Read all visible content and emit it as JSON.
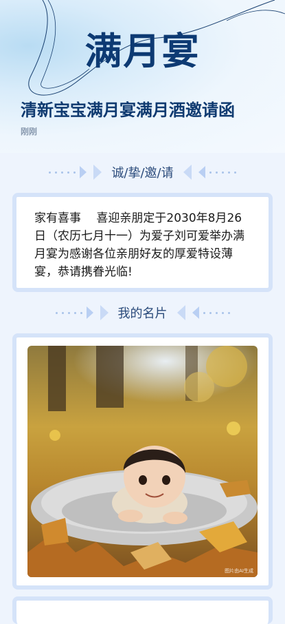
{
  "hero": {
    "title": "满月宴"
  },
  "page": {
    "title": "清新宝宝满月宴满月酒邀请函",
    "time": "刚刚"
  },
  "sections": {
    "invite_heading": "诚/挚/邀/请",
    "invite_text": "家有喜事　 喜迎亲朋定于2030年8月26日（农历七月十一）为爱子刘可爱举办满月宴为感谢各位亲朋好友的厚爱特设薄宴，恭请携眷光临!",
    "card_heading": "我的名片"
  },
  "photo": {
    "watermark": "图片由AI生成"
  },
  "colors": {
    "title_navy": "#0d3a73",
    "card_border": "#d5e3f9",
    "page_bg": "#eef4fd"
  }
}
